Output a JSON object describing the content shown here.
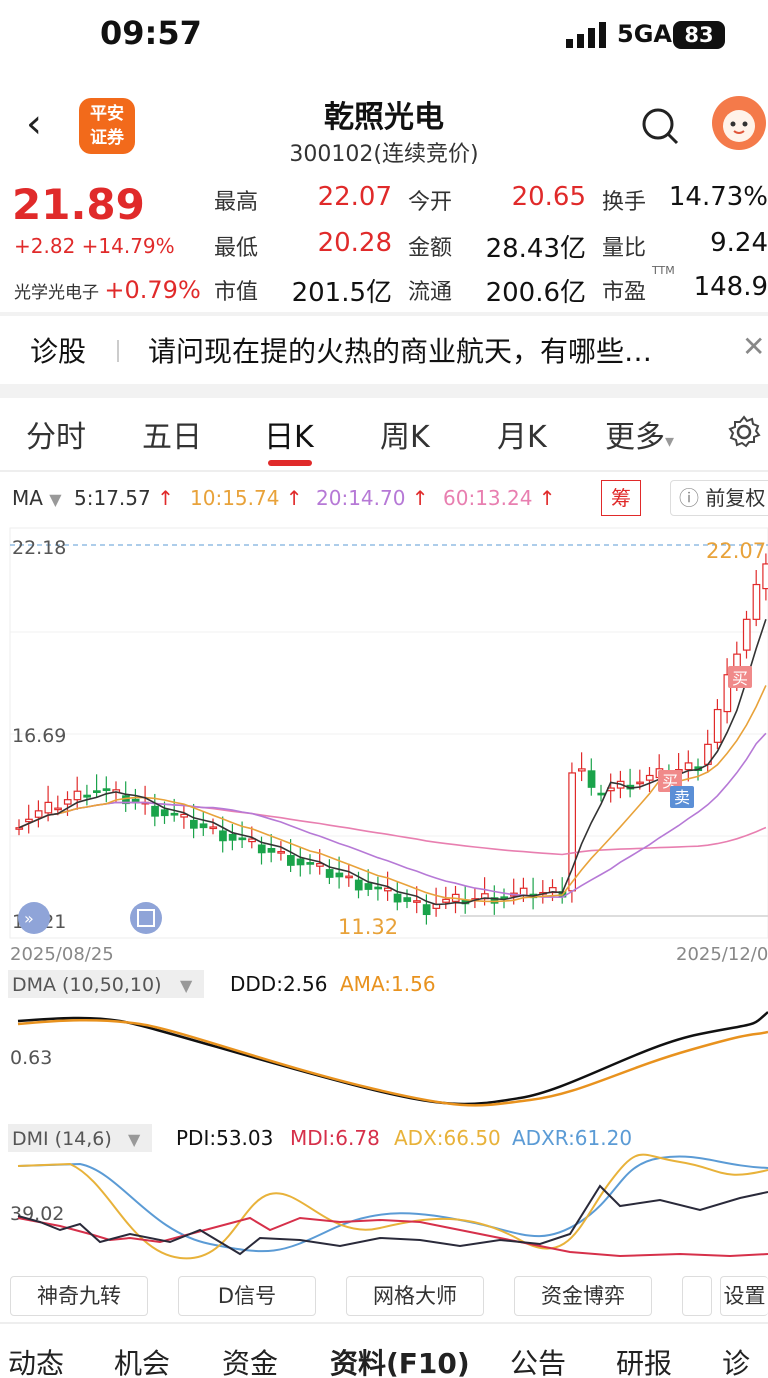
{
  "status": {
    "time": "09:57",
    "network": "5GA",
    "battery": "83"
  },
  "header": {
    "name": "乾照光电",
    "code": "300102(连续竞价)",
    "logo_line1": "平安",
    "logo_line2": "证券"
  },
  "quote": {
    "price": "21.89",
    "change": "+2.82 +14.79%",
    "sector_name": "光学光电子",
    "sector_change": "+0.79%",
    "items": [
      {
        "label": "最高",
        "value": "22.07",
        "color": "#e02a2a"
      },
      {
        "label": "今开",
        "value": "20.65",
        "color": "#e02a2a"
      },
      {
        "label": "换手",
        "value": "14.73%",
        "color": "#111111"
      },
      {
        "label": "最低",
        "value": "20.28",
        "color": "#e02a2a"
      },
      {
        "label": "金额",
        "value": "28.43亿",
        "color": "#111111"
      },
      {
        "label": "量比",
        "value": "9.24",
        "color": "#111111"
      },
      {
        "label": "市值",
        "value": "201.5亿",
        "color": "#111111"
      },
      {
        "label": "流通",
        "value": "200.6亿",
        "color": "#111111"
      },
      {
        "label": "市盈",
        "value": "148.9",
        "color": "#111111"
      }
    ],
    "ttm": "TTM"
  },
  "diagnosis": {
    "title": "诊股",
    "text": "请问现在提的火热的商业航天，有哪些…"
  },
  "tabs": [
    "分时",
    "五日",
    "日K",
    "周K",
    "月K",
    "更多"
  ],
  "ma": {
    "label": "MA",
    "items": [
      {
        "text": "5:17.57",
        "color": "#333333"
      },
      {
        "text": "10:15.74",
        "color": "#e8a23a"
      },
      {
        "text": "20:14.70",
        "color": "#b679d6"
      },
      {
        "text": "60:13.24",
        "color": "#e87fb0"
      }
    ],
    "chip": "筹",
    "fq": "前复权"
  },
  "kchart": {
    "top_price": "22.18",
    "mid_price": "16.69",
    "bottom_price": "11.21",
    "high_mark": "22.07",
    "low_mark": "11.32",
    "date_left": "2025/08/25",
    "date_right": "2025/12/0",
    "buy_label": "买",
    "sell_label": "卖"
  },
  "dma": {
    "label": "DMA (10,50,10)",
    "ddd": "DDD:2.56",
    "ama": "AMA:1.56",
    "tick": "0.63"
  },
  "dmi": {
    "label": "DMI (14,6)",
    "pdi": "PDI:53.03",
    "mdi": "MDI:6.78",
    "adx": "ADX:66.50",
    "adxr": "ADXR:61.20",
    "tick": "39.02"
  },
  "tools": [
    "神奇九转",
    "D信号",
    "网格大师",
    "资金博弈",
    "设置"
  ],
  "bottom_tabs": [
    "动态",
    "机会",
    "资金",
    "资料(F10)",
    "公告",
    "研报",
    "诊股"
  ],
  "colors": {
    "up": "#e02a2a",
    "down": "#1aa34a",
    "ma5": "#333333",
    "ma10": "#e8a23a",
    "ma20": "#b679d6",
    "ma60": "#e87fb0"
  }
}
